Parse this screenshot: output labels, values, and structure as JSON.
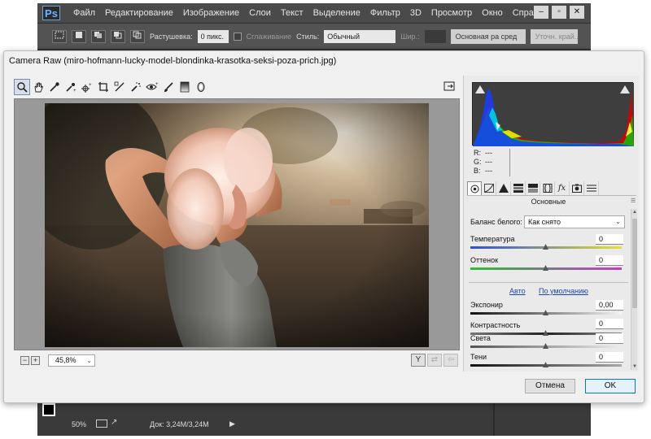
{
  "ps": {
    "logo": "Ps",
    "menu": [
      "Файл",
      "Редактирование",
      "Изображение",
      "Слои",
      "Текст",
      "Выделение",
      "Фильтр",
      "3D",
      "Просмотр",
      "Окно",
      "Справка"
    ],
    "window_buttons": [
      "‒",
      "▫",
      "✕"
    ],
    "options": {
      "feather_label": "Растушевка:",
      "feather_value": "0 пикс.",
      "antialias_label": "Сглаживание",
      "style_label": "Стиль:",
      "style_value": "Обычный",
      "width_label": "Шир.:",
      "select_mask_button": "Основная ра    сред",
      "refine_edge_button": "Уточн. край..."
    },
    "status": {
      "zoom": "50%",
      "doc_label": "Док: 3,24M/3,24M"
    }
  },
  "camera_raw": {
    "title": "Camera Raw (miro-hofmann-lucky-model-blondinka-krasotka-seksi-poza-prich.jpg)",
    "zoom_value": "45,8%",
    "tools": [
      "zoom-tool",
      "hand-tool",
      "white-balance-tool",
      "color-sampler-tool",
      "targeted-adjustment-tool",
      "crop-tool",
      "straighten-tool",
      "spot-removal-tool",
      "red-eye-tool",
      "adjustment-brush-tool",
      "graduated-filter-tool",
      "radial-filter-tool"
    ],
    "rgb": {
      "r_label": "R:",
      "g_label": "G:",
      "b_label": "B:",
      "r_value": "---",
      "g_value": "---",
      "b_value": "---"
    },
    "panel_name": "Основные",
    "white_balance": {
      "label": "Баланс белого:",
      "value": "Как снято"
    },
    "sliders": {
      "temperature": {
        "label": "Температура",
        "value": "0"
      },
      "tint": {
        "label": "Оттенок",
        "value": "0"
      },
      "exposure": {
        "label": "Экспонир",
        "value": "0,00"
      },
      "contrast": {
        "label": "Контрастность",
        "value": "0"
      },
      "highlights": {
        "label": "Света",
        "value": "0"
      },
      "shadows": {
        "label": "Тени",
        "value": "0"
      }
    },
    "links": {
      "auto": "Авто",
      "default": "По умолчанию"
    },
    "buttons": {
      "cancel": "Отмена",
      "ok": "OK"
    },
    "colors": {
      "ok_border": "#0078d7",
      "link": "#1a47b8"
    }
  }
}
